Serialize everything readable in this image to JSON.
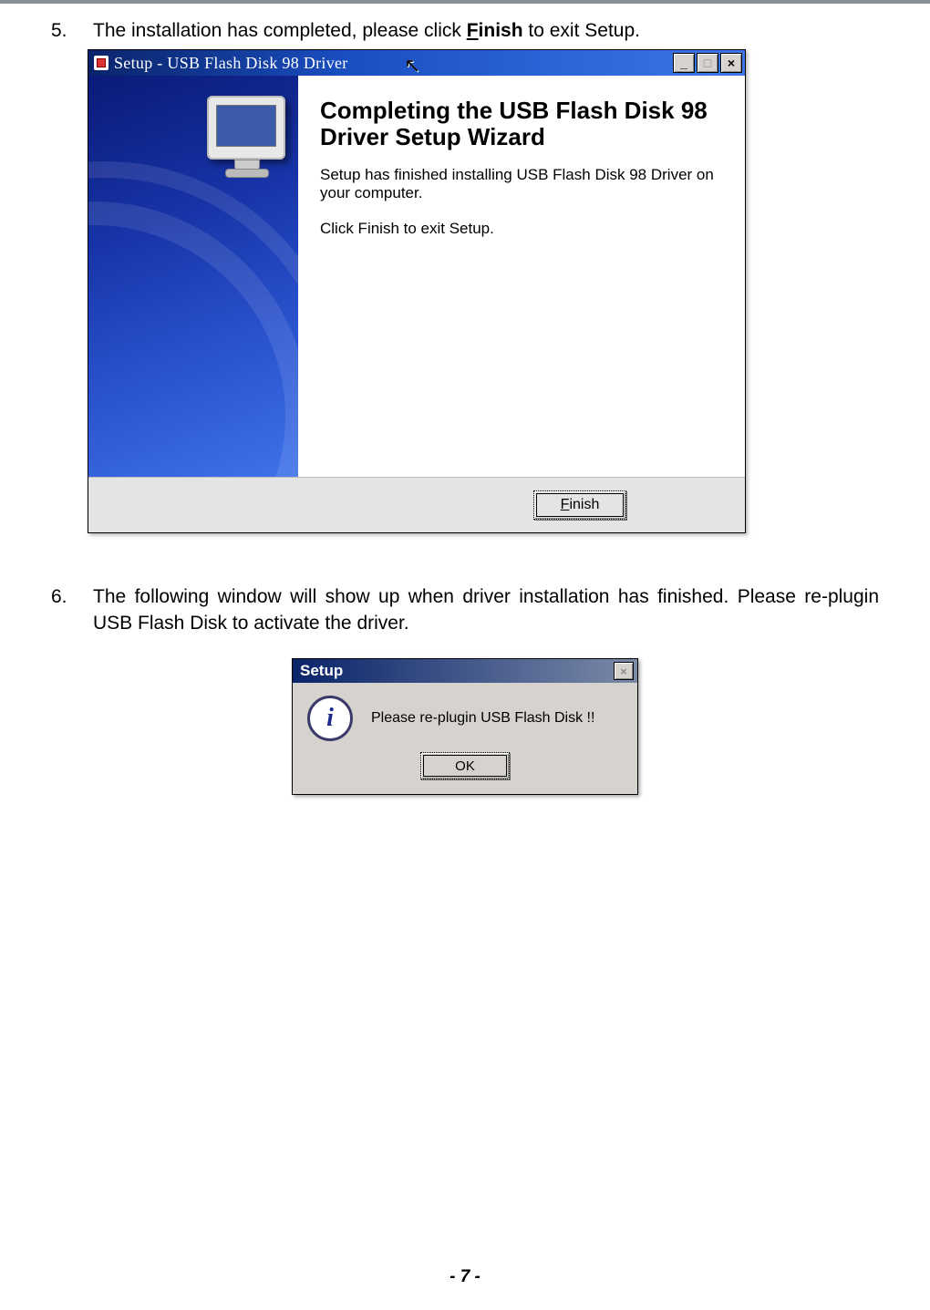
{
  "steps": {
    "s5_num": "5.",
    "s5_text_before": "The installation has completed, please click ",
    "s5_finish_label_first_letter": "F",
    "s5_finish_label_rest": "inish",
    "s5_text_after": " to exit Setup.",
    "s6_num": "6.",
    "s6_text": "The following window will show up when driver installation has finished. Please re-plugin USB Flash Disk to activate the driver."
  },
  "wizard": {
    "title": "Setup - USB Flash Disk 98 Driver",
    "heading": "Completing the USB Flash Disk 98 Driver Setup Wizard",
    "body1": "Setup has finished installing USB Flash Disk 98 Driver on your computer.",
    "body2": "Click Finish to exit Setup.",
    "finish_label_u": "F",
    "finish_label_rest": "inish",
    "min_glyph": "_",
    "max_glyph": "□",
    "close_glyph": "×"
  },
  "msgbox": {
    "title": "Setup",
    "close_glyph": "×",
    "info_glyph": "i",
    "text": "Please re-plugin USB Flash Disk !!",
    "ok_label": "OK"
  },
  "page_footer": "- 7 -"
}
